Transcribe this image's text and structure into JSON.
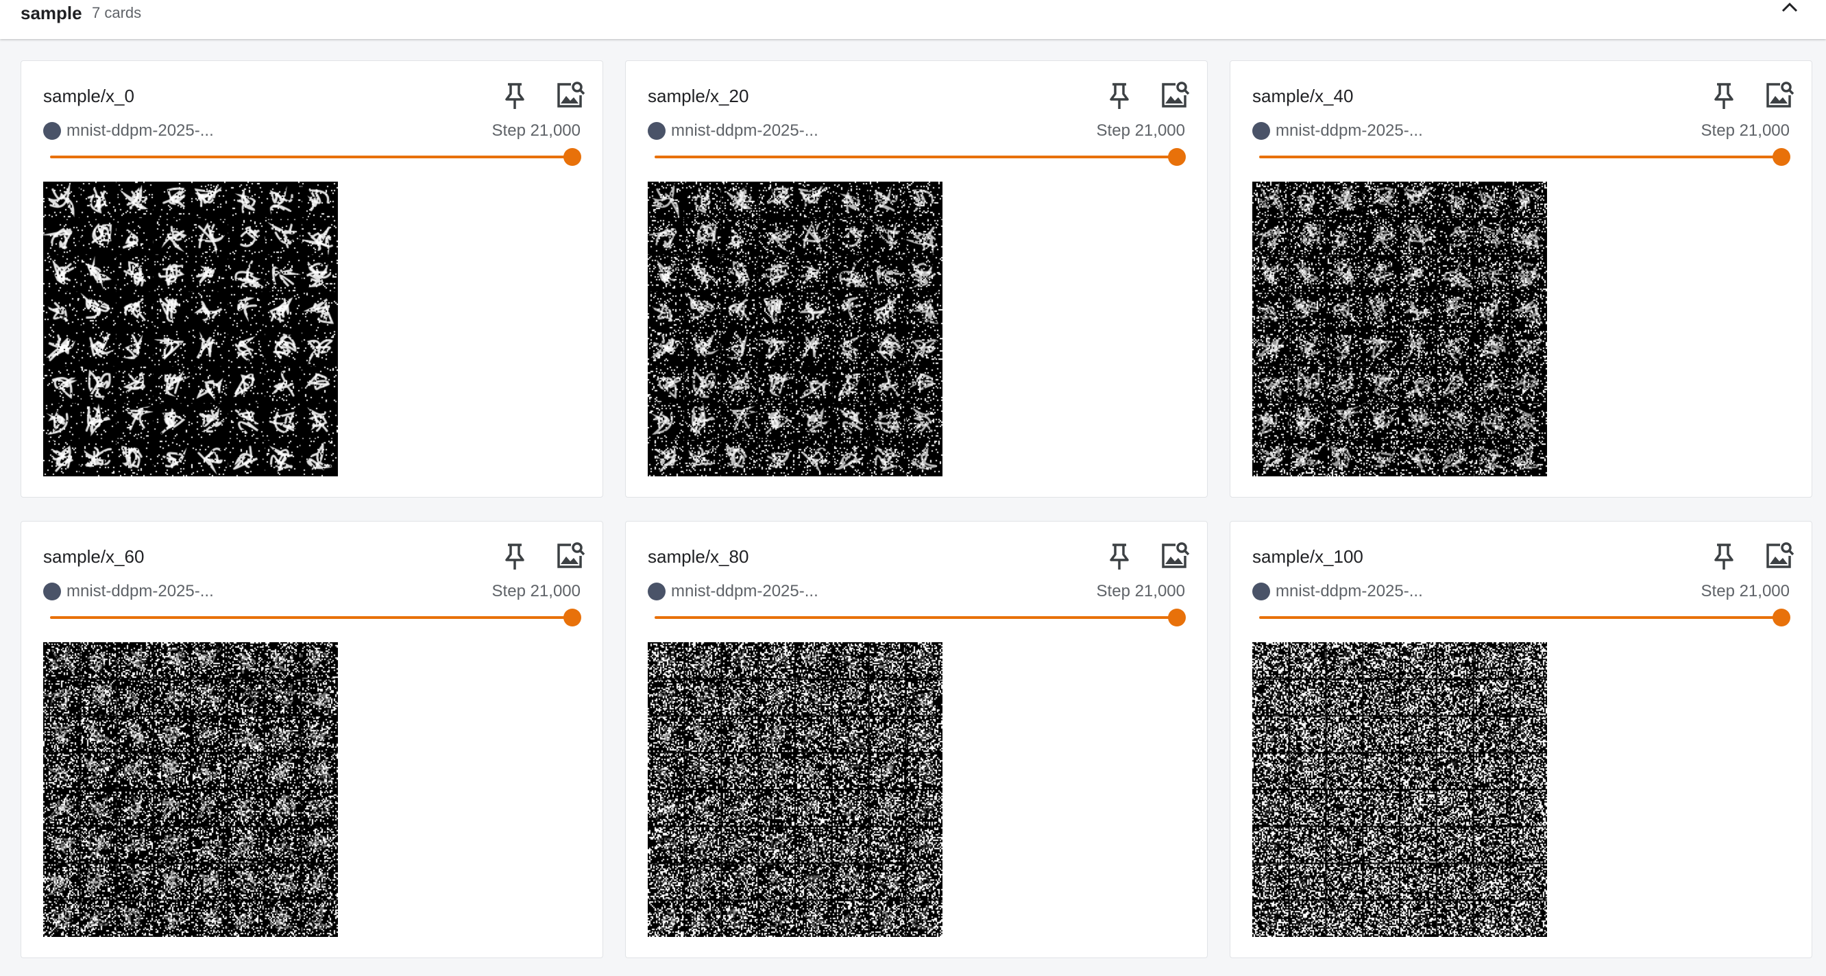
{
  "group": {
    "title": "sample",
    "count_label": "7 cards",
    "collapse_icon": "chevron-up-icon"
  },
  "colors": {
    "accent": "#e8710a",
    "run_dot": "#4a5368",
    "card_border": "#e1e3e6",
    "background": "#f5f6f8"
  },
  "cards": [
    {
      "title": "sample/x_0",
      "run": "mnist-ddpm-2025-...",
      "step": "Step 21,000",
      "slider_value": 1.0,
      "noise": 0.1
    },
    {
      "title": "sample/x_20",
      "run": "mnist-ddpm-2025-...",
      "step": "Step 21,000",
      "slider_value": 1.0,
      "noise": 0.22
    },
    {
      "title": "sample/x_40",
      "run": "mnist-ddpm-2025-...",
      "step": "Step 21,000",
      "slider_value": 1.0,
      "noise": 0.34
    },
    {
      "title": "sample/x_60",
      "run": "mnist-ddpm-2025-...",
      "step": "Step 21,000",
      "slider_value": 1.0,
      "noise": 0.46
    },
    {
      "title": "sample/x_80",
      "run": "mnist-ddpm-2025-...",
      "step": "Step 21,000",
      "slider_value": 1.0,
      "noise": 0.58
    },
    {
      "title": "sample/x_100",
      "run": "mnist-ddpm-2025-...",
      "step": "Step 21,000",
      "slider_value": 1.0,
      "noise": 0.7
    }
  ]
}
